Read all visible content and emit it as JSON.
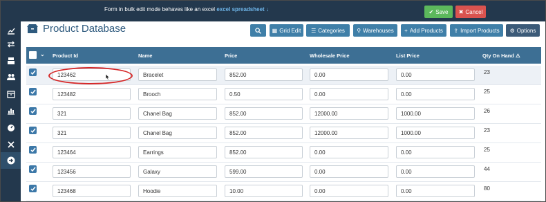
{
  "topbar": {
    "message_prefix": "Form in bulk edit mode behaves like an excel",
    "message_highlight": "excel spreadsheet",
    "save_label": "Save",
    "cancel_label": "Cancel"
  },
  "sidebar": {
    "items": [
      {
        "icon": "chart-trend-icon"
      },
      {
        "icon": "transfer-arrows-icon"
      },
      {
        "icon": "register-icon"
      },
      {
        "icon": "users-icon"
      },
      {
        "icon": "box-icon"
      },
      {
        "icon": "bar-chart-icon"
      },
      {
        "icon": "dashboard-icon"
      },
      {
        "icon": "tools-icon"
      },
      {
        "icon": "arrow-circle-right-icon",
        "active": true
      }
    ]
  },
  "page": {
    "title": "Product Database"
  },
  "toolbar": {
    "grid_edit": "Grid Edit",
    "categories": "Categories",
    "warehouses": "Warehouses",
    "add_products": "Add Products",
    "import_products": "Import Products",
    "options": "Options"
  },
  "table": {
    "columns": [
      "Product Id",
      "Name",
      "Price",
      "Wholesale Price",
      "List Price",
      "Qty On Hand"
    ],
    "rows": [
      {
        "product_id": "123462",
        "name": "Bracelet",
        "price": "852.00",
        "wholesale": "0.00",
        "list": "0.00",
        "qty": "23"
      },
      {
        "product_id": "123482",
        "name": "Brooch",
        "price": "0.50",
        "wholesale": "0.00",
        "list": "0.00",
        "qty": "25"
      },
      {
        "product_id": "321",
        "name": "Chanel Bag",
        "price": "852.00",
        "wholesale": "12000.00",
        "list": "1000.00",
        "qty": "26"
      },
      {
        "product_id": "321",
        "name": "Chanel Bag",
        "price": "852.00",
        "wholesale": "12000.00",
        "list": "1000.00",
        "qty": "23"
      },
      {
        "product_id": "123464",
        "name": "Earrings",
        "price": "852.00",
        "wholesale": "0.00",
        "list": "0.00",
        "qty": "25"
      },
      {
        "product_id": "123456",
        "name": "Galaxy",
        "price": "599.00",
        "wholesale": "0.00",
        "list": "0.00",
        "qty": "44"
      },
      {
        "product_id": "123468",
        "name": "Hoodie",
        "price": "10.00",
        "wholesale": "0.00",
        "list": "0.00",
        "qty": "80"
      }
    ]
  },
  "colors": {
    "topbar": "#23384d",
    "table_header": "#3d6f94",
    "toolbar_button": "#3f7fa8",
    "save": "#5cb85c",
    "cancel": "#d9534f",
    "annotation": "#d62828"
  }
}
